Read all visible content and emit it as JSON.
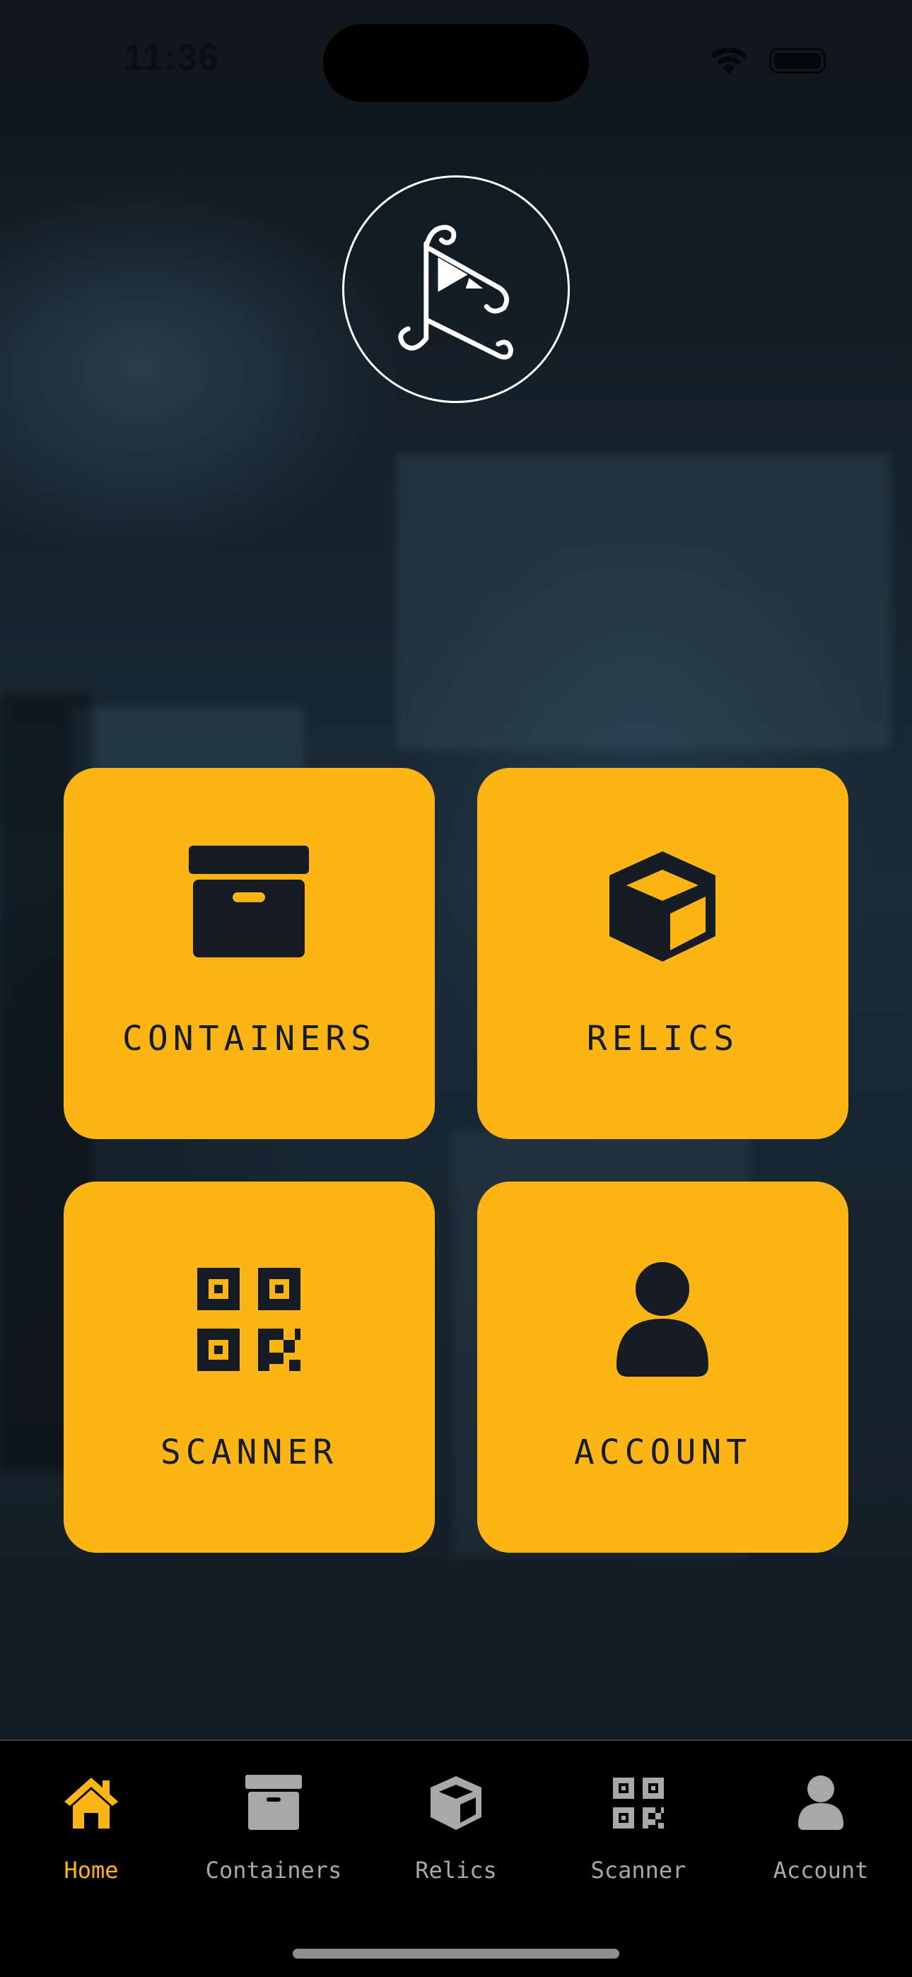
{
  "status_bar": {
    "time": "11:36"
  },
  "colors": {
    "accent": "#fdb515",
    "tile_text": "#161c26",
    "tab_inactive": "#a8a8a8",
    "tab_bar_bg": "#000000"
  },
  "tiles": [
    {
      "label": "CONTAINERS",
      "icon": "archive-box-icon"
    },
    {
      "label": "RELICS",
      "icon": "cube-icon"
    },
    {
      "label": "SCANNER",
      "icon": "qr-code-icon"
    },
    {
      "label": "ACCOUNT",
      "icon": "user-icon"
    }
  ],
  "tab_bar": {
    "active": "Home",
    "items": [
      {
        "label": "Home",
        "icon": "home-icon"
      },
      {
        "label": "Containers",
        "icon": "archive-box-icon"
      },
      {
        "label": "Relics",
        "icon": "cube-icon"
      },
      {
        "label": "Scanner",
        "icon": "qr-code-icon"
      },
      {
        "label": "Account",
        "icon": "user-icon"
      }
    ]
  }
}
